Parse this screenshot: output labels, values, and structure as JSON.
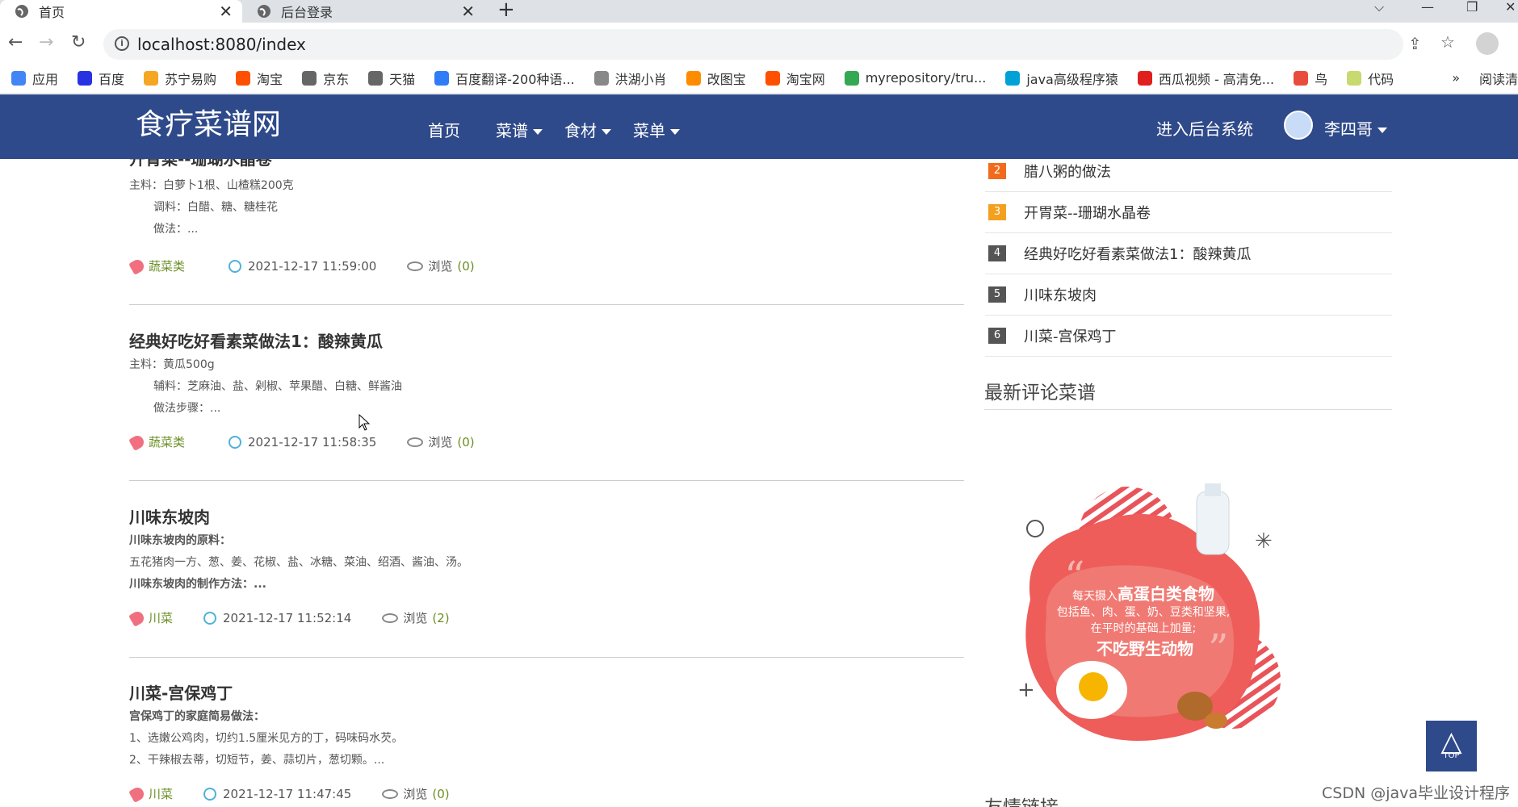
{
  "browser": {
    "tabs": [
      {
        "title": "首页",
        "active": true
      },
      {
        "title": "后台登录",
        "active": false
      }
    ],
    "url": "localhost:8080/index",
    "bookmarks": [
      {
        "label": "应用",
        "color": "#4285f4"
      },
      {
        "label": "百度",
        "color": "#2932e1"
      },
      {
        "label": "苏宁易购",
        "color": "#f5a623"
      },
      {
        "label": "淘宝",
        "color": "#ff5000"
      },
      {
        "label": "京东",
        "color": "#666666"
      },
      {
        "label": "天猫",
        "color": "#666666"
      },
      {
        "label": "百度翻译-200种语...",
        "color": "#2f7cf6"
      },
      {
        "label": "洪湖小肖",
        "color": "#888888"
      },
      {
        "label": "改图宝",
        "color": "#ff8c00"
      },
      {
        "label": "淘宝网",
        "color": "#ff5000"
      },
      {
        "label": "myrepository/tru...",
        "color": "#34a853"
      },
      {
        "label": "java高级程序猿",
        "color": "#00a1d6"
      },
      {
        "label": "西瓜视频 - 高清免...",
        "color": "#e0201f"
      },
      {
        "label": "鸟",
        "color": "#e84c3d"
      },
      {
        "label": "代码",
        "color": "#c8d96f"
      }
    ],
    "bookmarks_more": "»",
    "reading_list": "阅读清"
  },
  "site": {
    "logo": "食疗菜谱网",
    "nav": [
      {
        "label": "首页",
        "dropdown": false
      },
      {
        "label": "菜谱",
        "dropdown": true
      },
      {
        "label": "食材",
        "dropdown": true
      },
      {
        "label": "菜单",
        "dropdown": true
      }
    ],
    "admin_link": "进入后台系统",
    "username": "李四哥"
  },
  "articles": [
    {
      "title": "开胃菜--珊瑚水晶卷",
      "lines": [
        {
          "text": "主料：白萝卜1根、山楂糕200克",
          "indent": false,
          "bold": false
        },
        {
          "text": "调料：白醋、糖、糖桂花",
          "indent": true,
          "bold": false
        },
        {
          "text": "做法：...",
          "indent": true,
          "bold": false
        }
      ],
      "tag": "蔬菜类",
      "date": "2021-12-17 11:59:00",
      "views_label": "浏览",
      "views": "(0)"
    },
    {
      "title": "经典好吃好看素菜做法1：酸辣黄瓜",
      "lines": [
        {
          "text": "主料：黄瓜500g",
          "indent": false,
          "bold": false
        },
        {
          "text": "辅料：芝麻油、盐、剁椒、苹果醋、白糖、鲜酱油",
          "indent": true,
          "bold": false
        },
        {
          "text": "做法步骤：...",
          "indent": true,
          "bold": false
        }
      ],
      "tag": "蔬菜类",
      "date": "2021-12-17 11:58:35",
      "views_label": "浏览",
      "views": "(0)"
    },
    {
      "title": "川味东坡肉",
      "lines": [
        {
          "text": "川味东坡肉的原料：",
          "indent": false,
          "bold": true
        },
        {
          "text": "五花猪肉一方、葱、姜、花椒、盐、冰糖、菜油、绍酒、酱油、汤。",
          "indent": false,
          "bold": false
        },
        {
          "text": "川味东坡肉的制作方法：...",
          "indent": false,
          "bold": true
        }
      ],
      "tag": "川菜",
      "date": "2021-12-17 11:52:14",
      "views_label": "浏览",
      "views": "(2)"
    },
    {
      "title": "川菜-宫保鸡丁",
      "lines": [
        {
          "text": "宫保鸡丁的家庭简易做法：",
          "indent": false,
          "bold": true
        },
        {
          "text": "1、选嫩公鸡肉，切约1.5厘米见方的丁，码味码水芡。",
          "indent": false,
          "bold": false
        },
        {
          "text": "2、干辣椒去蒂，切短节，姜、蒜切片，葱切颗。...",
          "indent": false,
          "bold": false
        }
      ],
      "tag": "川菜",
      "date": "2021-12-17 11:47:45",
      "views_label": "浏览",
      "views": "(0)"
    }
  ],
  "ranking": [
    {
      "num": "2",
      "title": "腊八粥的做法",
      "color": "#f26b1d"
    },
    {
      "num": "3",
      "title": "开胃菜--珊瑚水晶卷",
      "color": "#f3a01f"
    },
    {
      "num": "4",
      "title": "经典好吃好看素菜做法1：酸辣黄瓜",
      "color": "#555555"
    },
    {
      "num": "5",
      "title": "川味东坡肉",
      "color": "#555555"
    },
    {
      "num": "6",
      "title": "川菜-宫保鸡丁",
      "color": "#555555"
    }
  ],
  "latest_comments_title": "最新评论菜谱",
  "promo": {
    "line1_prefix": "每天摄入",
    "line1_emph": "高蛋白类食物",
    "line2": "包括鱼、肉、蛋、奶、豆类和坚果,",
    "line3": "在平时的基础上加量;",
    "line4": "不吃野生动物"
  },
  "top_button": {
    "label": "TOP"
  },
  "friend_links_title": "友情链接",
  "watermark": "CSDN @java毕业设计程序"
}
